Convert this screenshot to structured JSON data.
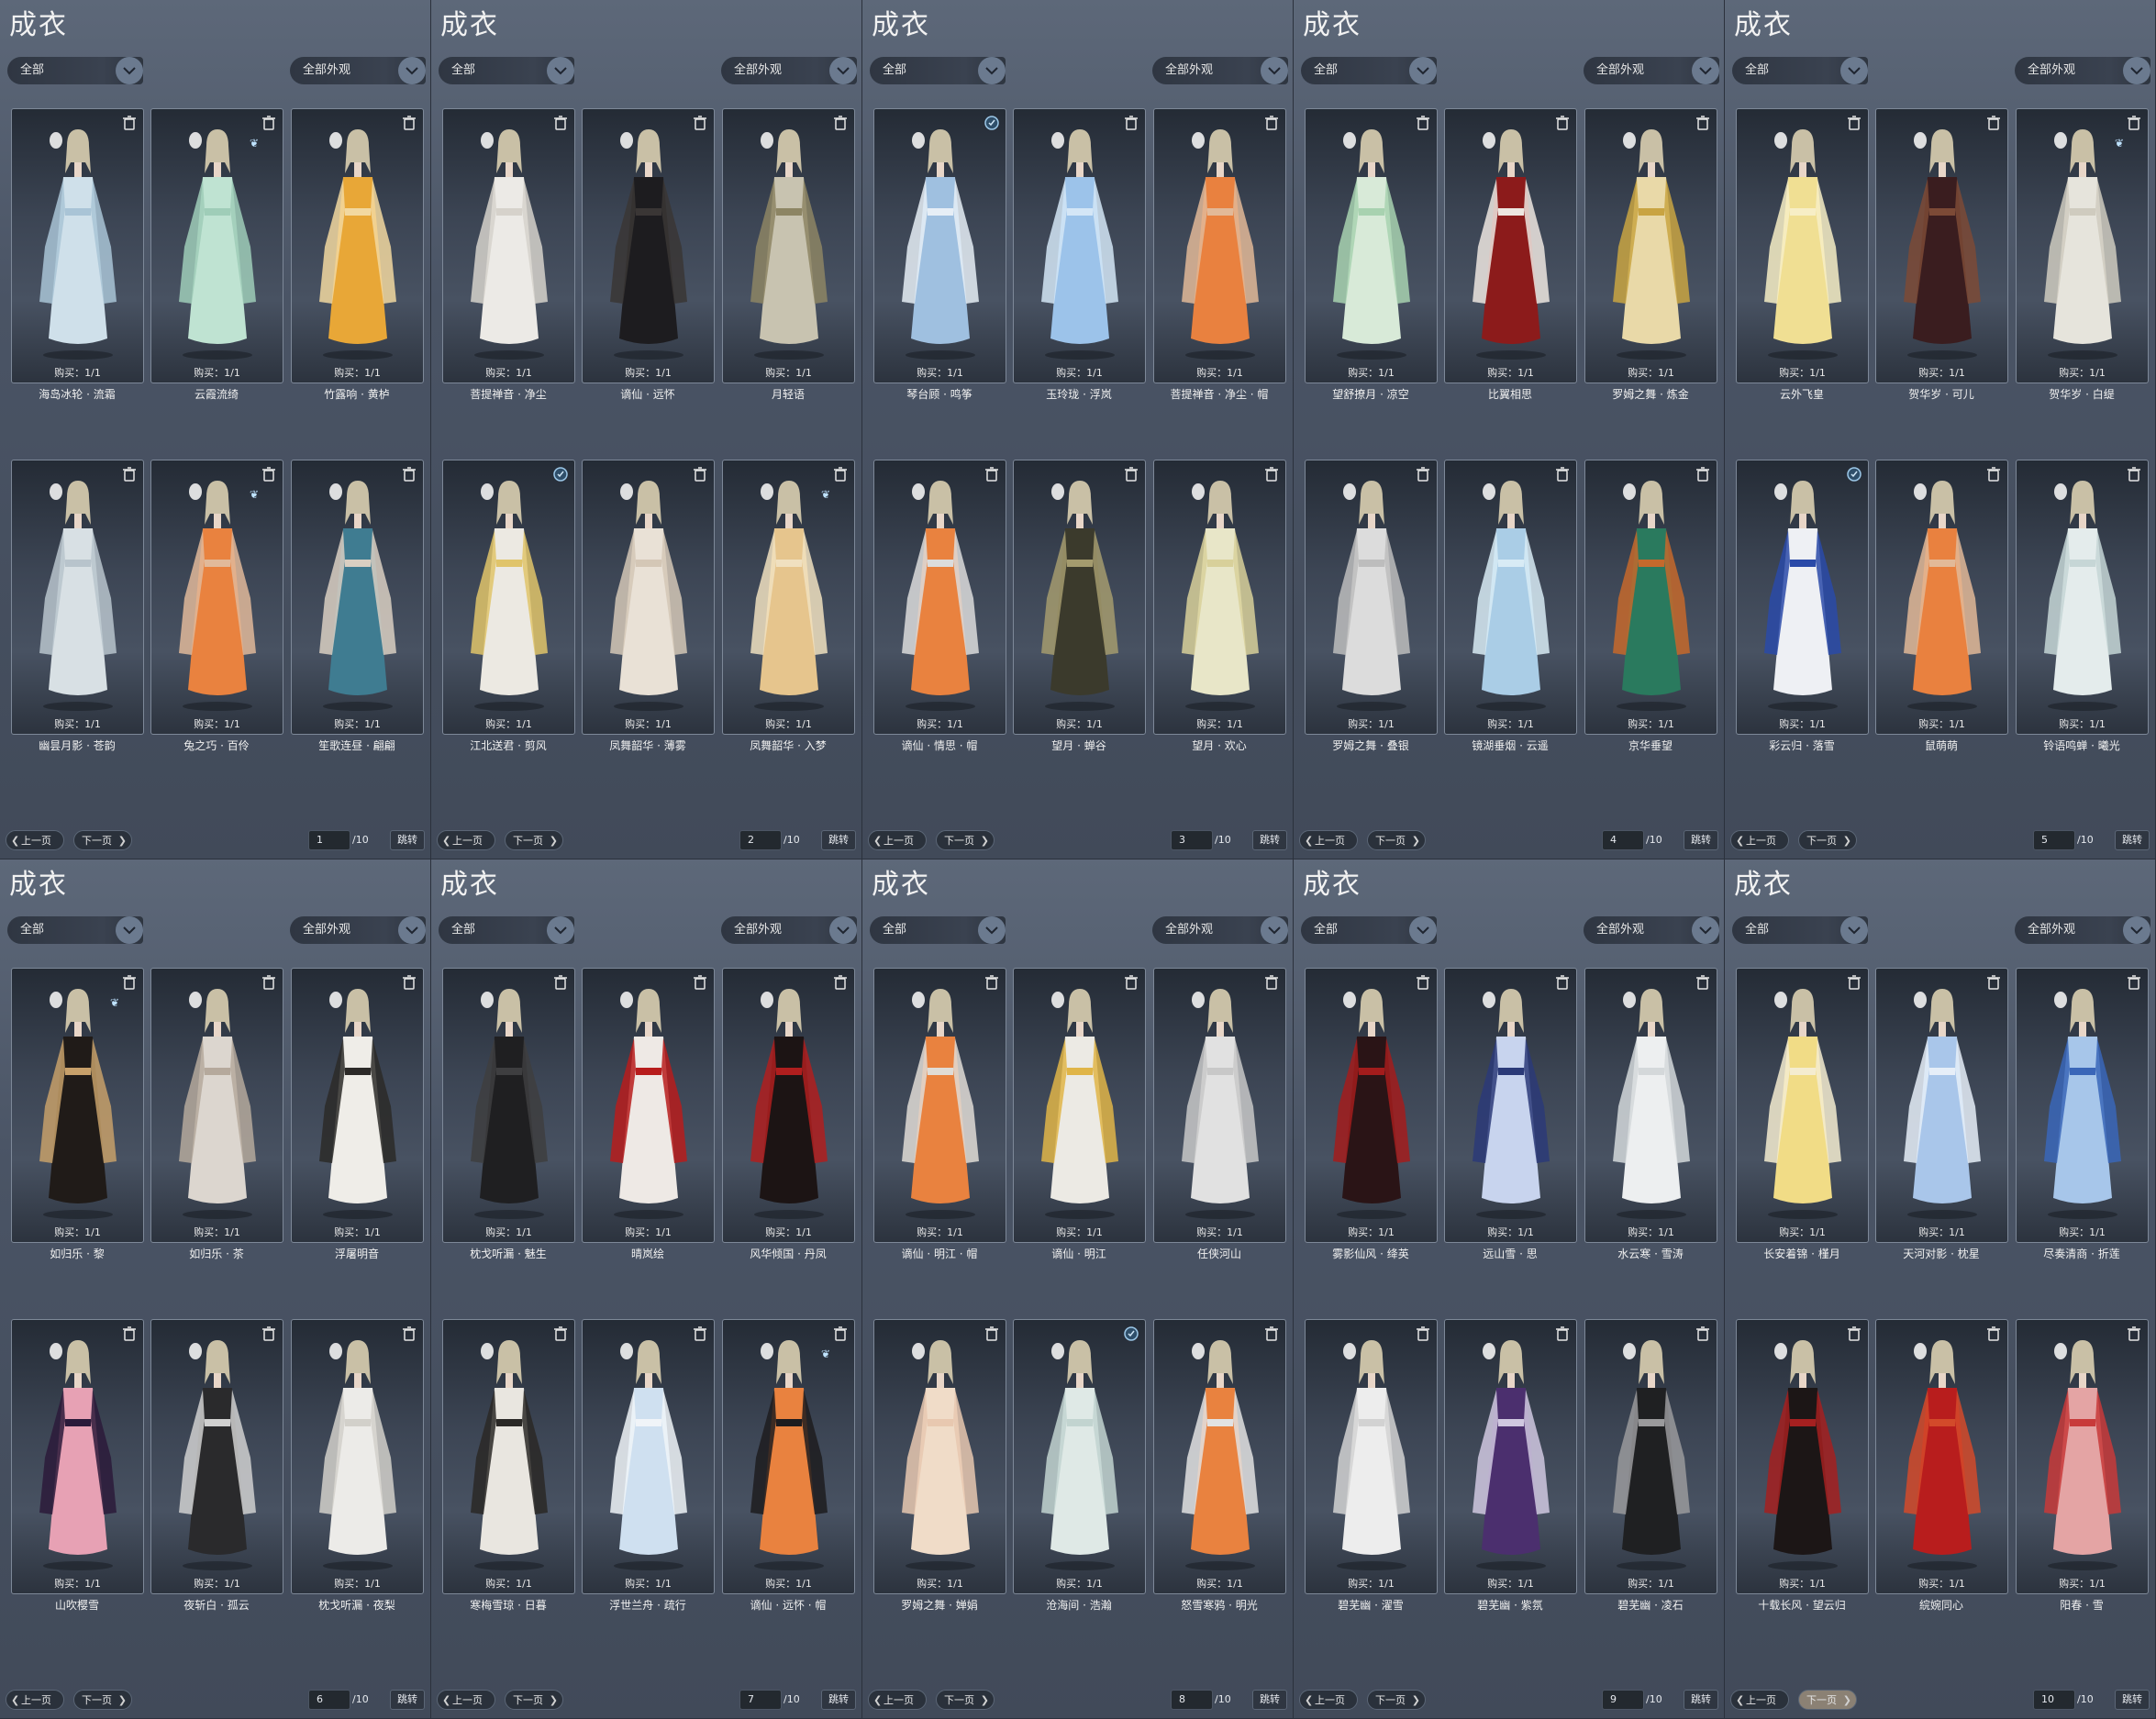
{
  "labels": {
    "title": "成衣",
    "filter1": "全部",
    "filter2": "全部外观",
    "buy": "购买：1/1",
    "prev": "上一页",
    "next": "下一页",
    "total": "/10",
    "jump": "跳转"
  },
  "colors": {
    "panel_bg": "#4a5465",
    "card_border": "#7d8898",
    "dropdown_accent": "#6b7a8f",
    "next_highlight": "#8b8174"
  },
  "pages": [
    {
      "page": "1",
      "items": [
        {
          "name": "海岛冰轮 · 流霜",
          "badge": "trash",
          "dress": "#cfe0ea",
          "accent": "#a9c4d6"
        },
        {
          "name": "云霞流绮",
          "badge": "trash",
          "butterfly": true,
          "dress": "#bfe3d2",
          "accent": "#9fcdb8"
        },
        {
          "name": "竹露响 · 黄栌",
          "badge": "trash",
          "dress": "#e8a737",
          "accent": "#f2d8a0"
        },
        {
          "name": "幽昙月影 · 苍韵",
          "badge": "trash",
          "dress": "#d8e0e4",
          "accent": "#b8c4cc"
        },
        {
          "name": "兔之巧 · 百伶",
          "badge": "trash",
          "butterfly": true,
          "dress": "#e9823f",
          "accent": "#e1b99a"
        },
        {
          "name": "笙歌连昼 · 翩翩",
          "badge": "trash",
          "dress": "#3f7c91",
          "accent": "#d9cfc2"
        }
      ]
    },
    {
      "page": "2",
      "items": [
        {
          "name": "菩提禅音 · 净尘",
          "badge": "trash",
          "dress": "#eceae6",
          "accent": "#d6d2cb"
        },
        {
          "name": "谪仙 · 远怀",
          "badge": "trash",
          "dress": "#1d1c1f",
          "accent": "#3a3635"
        },
        {
          "name": "月轻语",
          "badge": "trash",
          "dress": "#c8c3b0",
          "accent": "#8d8564"
        },
        {
          "name": "江北送君 · 剪风",
          "badge": "info",
          "dress": "#ece9e2",
          "accent": "#e0c46a"
        },
        {
          "name": "凤舞韶华 · 薄雾",
          "badge": "trash",
          "dress": "#e9e1d6",
          "accent": "#d4c7b6"
        },
        {
          "name": "凤舞韶华 · 入梦",
          "badge": "trash",
          "butterfly": true,
          "dress": "#e6c58d",
          "accent": "#f0e0c0"
        }
      ]
    },
    {
      "page": "3",
      "items": [
        {
          "name": "琴台顾 · 鸣筝",
          "badge": "info",
          "dress": "#9fc0e0",
          "accent": "#e6eef6"
        },
        {
          "name": "玉玲珑 · 浮岚",
          "badge": "trash",
          "dress": "#9cc3ea",
          "accent": "#d4e6f6"
        },
        {
          "name": "菩提禅音 · 净尘 · 帽",
          "badge": "trash",
          "dress": "#e9813f",
          "accent": "#e2b998"
        },
        {
          "name": "谪仙 · 情思 · 帽",
          "badge": "trash",
          "dress": "#e9823f",
          "accent": "#dcdcdc"
        },
        {
          "name": "望月 · 蝉谷",
          "badge": "trash",
          "dress": "#3b3a2c",
          "accent": "#a49b6e"
        },
        {
          "name": "望月 · 欢心",
          "badge": "trash",
          "dress": "#e8e6c8",
          "accent": "#d8d09a"
        }
      ]
    },
    {
      "page": "4",
      "items": [
        {
          "name": "望舒撩月 · 凉空",
          "badge": "trash",
          "dress": "#d8ead8",
          "accent": "#a8d2b0"
        },
        {
          "name": "比翼相思",
          "badge": "trash",
          "dress": "#8c1b1b",
          "accent": "#ede6e0"
        },
        {
          "name": "罗姆之舞 · 炼金",
          "badge": "trash",
          "dress": "#e9d9a8",
          "accent": "#c9a442"
        },
        {
          "name": "罗姆之舞 · 叠银",
          "badge": "trash",
          "dress": "#dcdcdc",
          "accent": "#bdbdbd"
        },
        {
          "name": "镜湖垂烟 · 云遥",
          "badge": "trash",
          "dress": "#aacde6",
          "accent": "#d8ebf5"
        },
        {
          "name": "京华垂望",
          "badge": "trash",
          "dress": "#2a7a5e",
          "accent": "#c5692c"
        }
      ]
    },
    {
      "page": "5",
      "items": [
        {
          "name": "云外飞皇",
          "badge": "trash",
          "dress": "#f0df93",
          "accent": "#f7eec6"
        },
        {
          "name": "贺华岁 · 可儿",
          "badge": "trash",
          "dress": "#3a1d1f",
          "accent": "#7c4a36"
        },
        {
          "name": "贺华岁 · 白缇",
          "badge": "trash",
          "butterfly": true,
          "dress": "#e6e4dc",
          "accent": "#cfcbbf"
        },
        {
          "name": "彩云归 · 落雪",
          "badge": "info",
          "dress": "#eef0f4",
          "accent": "#2a4aa8"
        },
        {
          "name": "鼠萌萌",
          "badge": "trash",
          "dress": "#e9813f",
          "accent": "#e2b998"
        },
        {
          "name": "铃语鸣蝉 · 曦光",
          "badge": "trash",
          "dress": "#e4ecec",
          "accent": "#c6d6d6"
        }
      ]
    },
    {
      "page": "6",
      "items": [
        {
          "name": "如归乐 · 黎",
          "badge": "trash",
          "butterfly": true,
          "dress": "#201b18",
          "accent": "#c7a06a"
        },
        {
          "name": "如归乐 · 茶",
          "badge": "trash",
          "dress": "#dcd6cf",
          "accent": "#b5a99c"
        },
        {
          "name": "浮屠明音",
          "badge": "trash",
          "dress": "#efede8",
          "accent": "#2c2a28"
        },
        {
          "name": "山吹樱雪",
          "badge": "trash",
          "dress": "#e7a1b4",
          "accent": "#2b1a3a"
        },
        {
          "name": "夜斩白 · 孤云",
          "badge": "trash",
          "dress": "#2a2a2c",
          "accent": "#d0d0d0"
        },
        {
          "name": "枕戈听漏 · 夜梨",
          "badge": "trash",
          "dress": "#ecebe8",
          "accent": "#d2d0ca"
        }
      ]
    },
    {
      "page": "7",
      "items": [
        {
          "name": "枕戈听漏 · 魅生",
          "badge": "trash",
          "dress": "#1f1f21",
          "accent": "#3e3e40"
        },
        {
          "name": "晴岚绘",
          "badge": "trash",
          "dress": "#eee9e5",
          "accent": "#b71c1c"
        },
        {
          "name": "风华倾国 · 丹凤",
          "badge": "trash",
          "dress": "#1c1414",
          "accent": "#b01e1e"
        },
        {
          "name": "寒梅雪琼 · 日暮",
          "badge": "trash",
          "dress": "#e9e6e0",
          "accent": "#2a2826"
        },
        {
          "name": "浮世兰舟 · 疏行",
          "badge": "trash",
          "dress": "#cfe0f0",
          "accent": "#f0f4f8"
        },
        {
          "name": "谪仙 · 远怀 · 帽",
          "badge": "trash",
          "butterfly": true,
          "dress": "#e9823f",
          "accent": "#1d1c1f"
        }
      ]
    },
    {
      "page": "8",
      "items": [
        {
          "name": "谪仙 · 明江 · 帽",
          "badge": "trash",
          "dress": "#e9823f",
          "accent": "#e0dcd6"
        },
        {
          "name": "谪仙 · 明江",
          "badge": "trash",
          "dress": "#eceae4",
          "accent": "#e0b548"
        },
        {
          "name": "任侠河山",
          "badge": "trash",
          "dress": "#e1e1e1",
          "accent": "#c8c8c8"
        },
        {
          "name": "罗姆之舞 · 婵娟",
          "badge": "trash",
          "dress": "#f0dcc8",
          "accent": "#e8c8b0"
        },
        {
          "name": "沧海间 · 浩瀚",
          "badge": "info",
          "dress": "#dfe9e6",
          "accent": "#c2d4d0"
        },
        {
          "name": "怒雪寒鸦 · 明光",
          "badge": "trash",
          "dress": "#e9823f",
          "accent": "#e2e2e2"
        }
      ]
    },
    {
      "page": "9",
      "items": [
        {
          "name": "雾影仙风 · 绛英",
          "badge": "trash",
          "dress": "#2a1416",
          "accent": "#a31c1c"
        },
        {
          "name": "远山雪 · 思",
          "badge": "trash",
          "dress": "#c8d4ee",
          "accent": "#2b3a78"
        },
        {
          "name": "水云寒 · 雪涛",
          "badge": "trash",
          "dress": "#edeff0",
          "accent": "#d4d8da"
        },
        {
          "name": "碧芜幽 · 濯雪",
          "badge": "trash",
          "dress": "#ededed",
          "accent": "#d2d2d2"
        },
        {
          "name": "碧芜幽 · 紫氛",
          "badge": "trash",
          "dress": "#4b2f6e",
          "accent": "#d0c8e0"
        },
        {
          "name": "碧芜幽 · 凌石",
          "badge": "trash",
          "dress": "#1f2022",
          "accent": "#9a9a9c"
        }
      ]
    },
    {
      "page": "10",
      "items": [
        {
          "name": "长安着锦 · 槿月",
          "badge": "trash",
          "dress": "#f1dc86",
          "accent": "#f4ecd0"
        },
        {
          "name": "天河对影 · 枕星",
          "badge": "trash",
          "dress": "#a9c6ea",
          "accent": "#e6eef8"
        },
        {
          "name": "尽奏清商 · 折莲",
          "badge": "trash",
          "dress": "#a7c6ea",
          "accent": "#3a66b8"
        },
        {
          "name": "十载长风 · 望云归",
          "badge": "trash",
          "dress": "#1c1616",
          "accent": "#a52020"
        },
        {
          "name": "綄婉同心",
          "badge": "trash",
          "dress": "#b81d1d",
          "accent": "#d34a2a"
        },
        {
          "name": "阳春 · 雪",
          "badge": "trash",
          "dress": "#e4a4a4",
          "accent": "#c83a3a"
        }
      ]
    }
  ]
}
